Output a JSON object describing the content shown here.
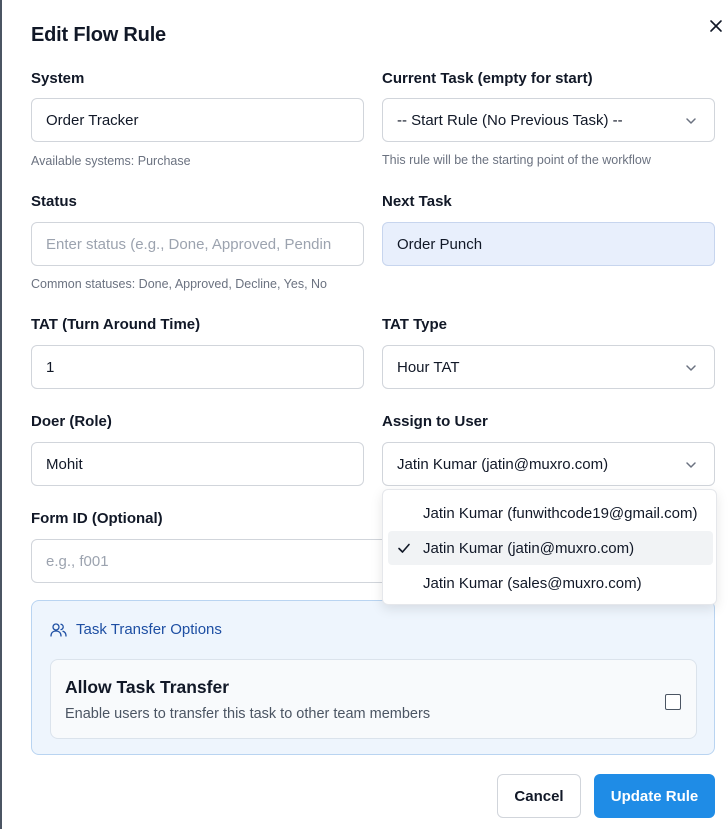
{
  "dialog": {
    "title": "Edit Flow Rule"
  },
  "system": {
    "label": "System",
    "value": "Order Tracker",
    "help": "Available systems: Purchase"
  },
  "current_task": {
    "label": "Current Task (empty for start)",
    "value": "-- Start Rule (No Previous Task) --",
    "help": "This rule will be the starting point of the workflow"
  },
  "status": {
    "label": "Status",
    "placeholder": "Enter status (e.g., Done, Approved, Pendin",
    "help": "Common statuses: Done, Approved, Decline, Yes, No"
  },
  "next_task": {
    "label": "Next Task",
    "value": "Order Punch"
  },
  "tat": {
    "label": "TAT (Turn Around Time)",
    "value": "1"
  },
  "tat_type": {
    "label": "TAT Type",
    "value": "Hour TAT"
  },
  "doer": {
    "label": "Doer (Role)",
    "value": "Mohit"
  },
  "assign_user": {
    "label": "Assign to User",
    "value": "Jatin Kumar (jatin@muxro.com)",
    "options": [
      "Jatin Kumar (funwithcode19@gmail.com)",
      "Jatin Kumar (jatin@muxro.com)",
      "Jatin Kumar (sales@muxro.com)"
    ]
  },
  "form_id": {
    "label": "Form ID (Optional)",
    "placeholder": "e.g., f001"
  },
  "transfer": {
    "heading": "Task Transfer Options",
    "title": "Allow Task Transfer",
    "description": "Enable users to transfer this task to other team members",
    "checked": false
  },
  "buttons": {
    "cancel": "Cancel",
    "update": "Update Rule"
  },
  "colors": {
    "primary": "#1f8ce6",
    "transfer_bg": "#eef5fd",
    "transfer_text": "#1e4fa3",
    "next_task_bg": "#e8effc"
  }
}
